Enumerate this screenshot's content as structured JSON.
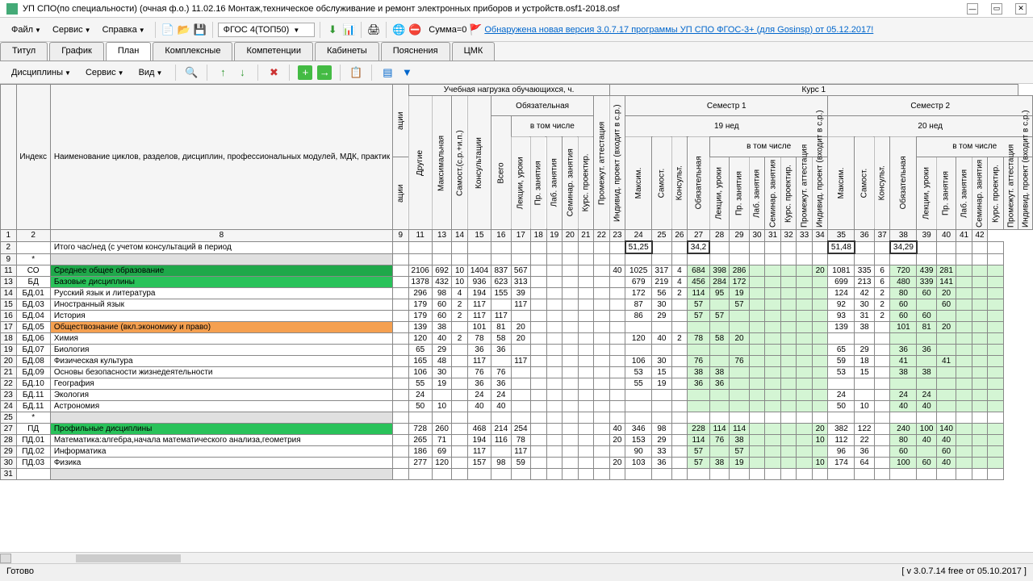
{
  "title": "УП СПО(по специальности) (очная ф.о.) 11.02.16 Монтаж,техническое обслуживание и ремонт электронных приборов и устройств.osf1-2018.osf",
  "menu": {
    "file": "Файл",
    "service": "Сервис",
    "help": "Справка",
    "fgos": "ФГОС 4(ТОП50)",
    "summa": "Сумма=0",
    "update": "Обнаружена новая версия 3.0.7.17 программы УП СПО ФГОС-3+ (для Gosinsp) от 05.12.2017!"
  },
  "tabs": [
    "Титул",
    "График",
    "План",
    "Комплексные",
    "Компетенции",
    "Кабинеты",
    "Пояснения",
    "ЦМК"
  ],
  "subtb": {
    "disc": "Дисциплины",
    "service": "Сервис",
    "view": "Вид"
  },
  "headers": {
    "index": "Индекс",
    "name": "Наименование циклов, разделов, дисциплин, профессиональных модулей, МДК, практик",
    "acii": "ации",
    "load": "Учебная нагрузка обучающихся, ч.",
    "course1": "Курс 1",
    "obyaz": "Обязательная",
    "vtom": "в том числе",
    "sem1": "Семестр 1",
    "sem2": "Семестр 2",
    "w19": "19 нед",
    "w20": "20 нед",
    "other": "Другие",
    "max": "Максимальная",
    "samost": "Самост.(с.р.+и.п.)",
    "konsult": "Консультации",
    "vsego": "Всего",
    "lek": "Лекции, уроки",
    "pr": "Пр. занятия",
    "lab": "Лаб. занятия",
    "sem": "Семинар. занятия",
    "kurs": "Курс. проектир.",
    "prom": "Промежут. аттестация",
    "indiv": "Индивид. проект (входит в с.р.)",
    "maksim": "Максим.",
    "samost2": "Самост.",
    "konsult2": "Консульт.",
    "obyaz2": "Обязательная",
    "numrow": [
      "1",
      "2",
      "8",
      "9",
      "11",
      "13",
      "14",
      "15",
      "16",
      "17",
      "18",
      "19",
      "20",
      "21",
      "22",
      "23",
      "24",
      "25",
      "26",
      "27",
      "28",
      "29",
      "30",
      "31",
      "32",
      "33",
      "34",
      "35",
      "36",
      "37",
      "38",
      "39",
      "40",
      "41",
      "42"
    ]
  },
  "totalrow": "Итого час/нед (с учетом консультаций в период",
  "totals": {
    "c23": "51,25",
    "c26": "34,2",
    "c34": "51,48",
    "c37": "34,29"
  },
  "rows": [
    {
      "n": "11",
      "idx": "СО",
      "name": "Среднее общее образование",
      "cls": "green-dark",
      "v": {
        "9": "2106",
        "11": "692",
        "13": "10",
        "14": "1404",
        "15": "837",
        "16": "567",
        "22": "40",
        "23": "1025",
        "24": "317",
        "25": "4",
        "26": "684",
        "27": "398",
        "28": "286",
        "33": "20",
        "34": "1081",
        "35": "335",
        "36": "6",
        "37": "720",
        "38": "439",
        "39": "281"
      }
    },
    {
      "n": "13",
      "idx": "БД",
      "name": "Базовые дисциплины",
      "cls": "green-med",
      "v": {
        "9": "1378",
        "11": "432",
        "13": "10",
        "14": "936",
        "15": "623",
        "16": "313",
        "23": "679",
        "24": "219",
        "25": "4",
        "26": "456",
        "27": "284",
        "28": "172",
        "34": "699",
        "35": "213",
        "36": "6",
        "37": "480",
        "38": "339",
        "39": "141"
      }
    },
    {
      "n": "14",
      "idx": "БД.01",
      "name": "Русский язык и литература",
      "v": {
        "9": "296",
        "11": "98",
        "13": "4",
        "14": "194",
        "15": "155",
        "16": "39",
        "23": "172",
        "24": "56",
        "25": "2",
        "26": "114",
        "27": "95",
        "28": "19",
        "34": "124",
        "35": "42",
        "36": "2",
        "37": "80",
        "38": "60",
        "39": "20"
      }
    },
    {
      "n": "15",
      "idx": "БД.03",
      "name": "Иностранный язык",
      "v": {
        "9": "179",
        "11": "60",
        "13": "2",
        "14": "117",
        "16": "117",
        "23": "87",
        "24": "30",
        "26": "57",
        "28": "57",
        "34": "92",
        "35": "30",
        "36": "2",
        "37": "60",
        "39": "60"
      }
    },
    {
      "n": "16",
      "idx": "БД.04",
      "name": "История",
      "v": {
        "9": "179",
        "11": "60",
        "13": "2",
        "14": "117",
        "15": "117",
        "23": "86",
        "24": "29",
        "26": "57",
        "27": "57",
        "34": "93",
        "35": "31",
        "36": "2",
        "37": "60",
        "38": "60"
      }
    },
    {
      "n": "17",
      "idx": "БД.05",
      "name": "Обществознание (вкл.экономику и право)",
      "cls": "orange",
      "v": {
        "9": "139",
        "11": "38",
        "14": "101",
        "15": "81",
        "16": "20",
        "34": "139",
        "35": "38",
        "37": "101",
        "38": "81",
        "39": "20"
      }
    },
    {
      "n": "18",
      "idx": "БД.06",
      "name": "Химия",
      "v": {
        "9": "120",
        "11": "40",
        "13": "2",
        "14": "78",
        "15": "58",
        "16": "20",
        "23": "120",
        "24": "40",
        "25": "2",
        "26": "78",
        "27": "58",
        "28": "20"
      }
    },
    {
      "n": "19",
      "idx": "БД.07",
      "name": "Биология",
      "v": {
        "9": "65",
        "11": "29",
        "14": "36",
        "15": "36",
        "34": "65",
        "35": "29",
        "37": "36",
        "38": "36"
      }
    },
    {
      "n": "20",
      "idx": "БД.08",
      "name": "Физическая культура",
      "v": {
        "9": "165",
        "11": "48",
        "14": "117",
        "16": "117",
        "23": "106",
        "24": "30",
        "26": "76",
        "28": "76",
        "34": "59",
        "35": "18",
        "37": "41",
        "39": "41"
      }
    },
    {
      "n": "21",
      "idx": "БД.09",
      "name": "Основы безопасности жизнедеятельности",
      "v": {
        "9": "106",
        "11": "30",
        "14": "76",
        "15": "76",
        "23": "53",
        "24": "15",
        "26": "38",
        "27": "38",
        "34": "53",
        "35": "15",
        "37": "38",
        "38": "38"
      }
    },
    {
      "n": "22",
      "idx": "БД.10",
      "name": "География",
      "v": {
        "9": "55",
        "11": "19",
        "14": "36",
        "15": "36",
        "23": "55",
        "24": "19",
        "26": "36",
        "27": "36"
      }
    },
    {
      "n": "23",
      "idx": "БД.11",
      "name": "Экология",
      "v": {
        "9": "24",
        "14": "24",
        "15": "24",
        "34": "24",
        "37": "24",
        "38": "24"
      }
    },
    {
      "n": "24",
      "idx": "БД.11",
      "name": "Астрономия",
      "v": {
        "9": "50",
        "11": "10",
        "14": "40",
        "15": "40",
        "34": "50",
        "35": "10",
        "37": "40",
        "38": "40"
      }
    },
    {
      "n": "25",
      "idx": "*",
      "name": "",
      "cls": "gap",
      "v": {}
    },
    {
      "n": "27",
      "idx": "ПД",
      "name": "Профильные дисциплины",
      "cls": "green-med",
      "v": {
        "9": "728",
        "11": "260",
        "14": "468",
        "15": "214",
        "16": "254",
        "22": "40",
        "23": "346",
        "24": "98",
        "26": "228",
        "27": "114",
        "28": "114",
        "33": "20",
        "34": "382",
        "35": "122",
        "37": "240",
        "38": "100",
        "39": "140"
      }
    },
    {
      "n": "28",
      "idx": "ПД.01",
      "name": "Математика:алгебра,начала математического анализа,геометрия",
      "v": {
        "9": "265",
        "11": "71",
        "14": "194",
        "15": "116",
        "16": "78",
        "22": "20",
        "23": "153",
        "24": "29",
        "26": "114",
        "27": "76",
        "28": "38",
        "33": "10",
        "34": "112",
        "35": "22",
        "37": "80",
        "38": "40",
        "39": "40"
      }
    },
    {
      "n": "29",
      "idx": "ПД.02",
      "name": "Информатика",
      "v": {
        "9": "186",
        "11": "69",
        "14": "117",
        "16": "117",
        "23": "90",
        "24": "33",
        "26": "57",
        "28": "57",
        "34": "96",
        "35": "36",
        "37": "60",
        "39": "60"
      }
    },
    {
      "n": "30",
      "idx": "ПД.03",
      "name": "Физика",
      "v": {
        "9": "277",
        "11": "120",
        "14": "157",
        "15": "98",
        "16": "59",
        "22": "20",
        "23": "103",
        "24": "36",
        "26": "57",
        "27": "38",
        "28": "19",
        "33": "10",
        "34": "174",
        "35": "64",
        "37": "100",
        "38": "60",
        "39": "40"
      }
    },
    {
      "n": "31",
      "idx": "",
      "name": "",
      "cls": "gap",
      "v": {}
    }
  ],
  "status": {
    "ready": "Готово",
    "version": "[ v 3.0.7.14 free от 05.10.2017 ]"
  }
}
